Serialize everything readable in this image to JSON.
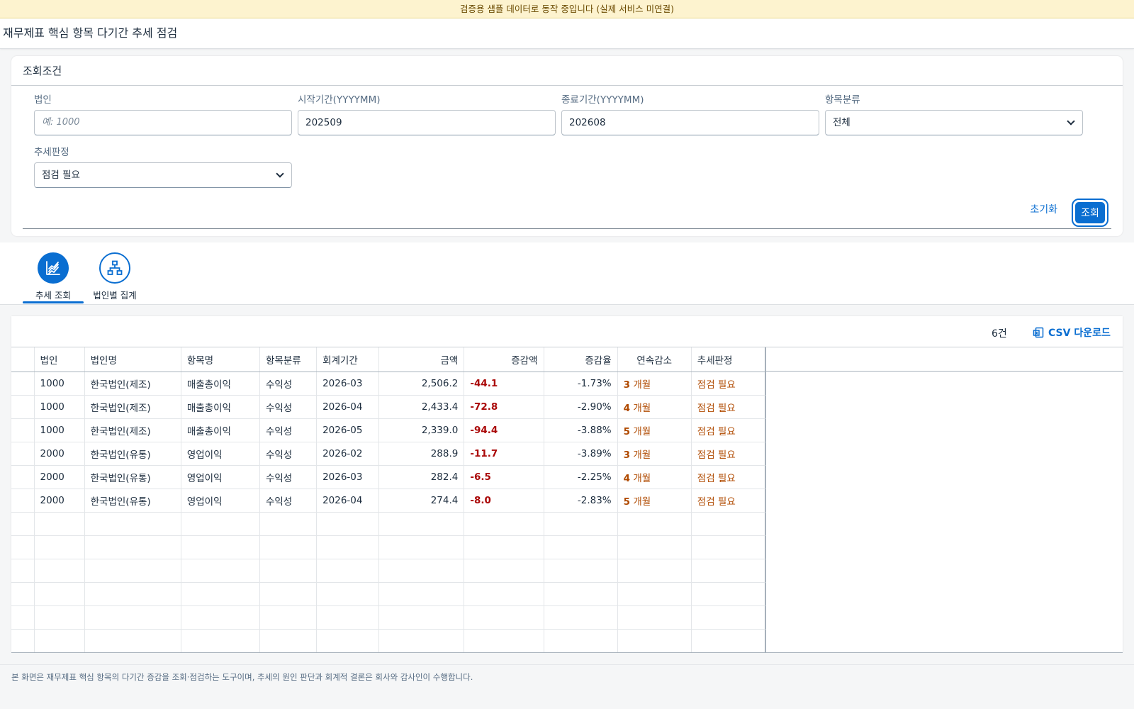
{
  "banner": {
    "text": "검증용 샘플 데이터로 동작 중입니다 (실제 서비스 미연결)"
  },
  "shell": {
    "title": "재무제표 핵심 항목 다기간 추세 점검"
  },
  "filter": {
    "title": "조회조건",
    "fields": {
      "corp": {
        "label": "법인",
        "placeholder": "예: 1000",
        "value": ""
      },
      "start": {
        "label": "시작기간(YYYYMM)",
        "value": "202509"
      },
      "end": {
        "label": "종료기간(YYYYMM)",
        "value": "202608"
      },
      "category": {
        "label": "항목분류",
        "value": "전체"
      },
      "trend": {
        "label": "추세판정",
        "value": "점검 필요"
      }
    },
    "reset_label": "초기화",
    "search_label": "조회"
  },
  "tabs": [
    {
      "label": "추세 조회",
      "icon": "line-chart-icon",
      "active": true
    },
    {
      "label": "법인별 집계",
      "icon": "org-hierarchy-icon",
      "active": false
    }
  ],
  "table": {
    "count": "6건",
    "csv_label": "CSV 다운로드",
    "columns": [
      "법인",
      "법인명",
      "항목명",
      "항목분류",
      "회계기간",
      "금액",
      "증감액",
      "증감율",
      "연속감소",
      "추세판정"
    ],
    "rows": [
      {
        "corp": "1000",
        "corp_name": "한국법인(제조)",
        "item": "매출총이익",
        "category": "수익성",
        "period": "2026-03",
        "amount": "2,506.2",
        "change": "-44.1",
        "rate": "-1.73%",
        "streak_num": "3",
        "streak_unit": "개월",
        "judgement": "점검 필요"
      },
      {
        "corp": "1000",
        "corp_name": "한국법인(제조)",
        "item": "매출총이익",
        "category": "수익성",
        "period": "2026-04",
        "amount": "2,433.4",
        "change": "-72.8",
        "rate": "-2.90%",
        "streak_num": "4",
        "streak_unit": "개월",
        "judgement": "점검 필요"
      },
      {
        "corp": "1000",
        "corp_name": "한국법인(제조)",
        "item": "매출총이익",
        "category": "수익성",
        "period": "2026-05",
        "amount": "2,339.0",
        "change": "-94.4",
        "rate": "-3.88%",
        "streak_num": "5",
        "streak_unit": "개월",
        "judgement": "점검 필요"
      },
      {
        "corp": "2000",
        "corp_name": "한국법인(유통)",
        "item": "영업이익",
        "category": "수익성",
        "period": "2026-02",
        "amount": "288.9",
        "change": "-11.7",
        "rate": "-3.89%",
        "streak_num": "3",
        "streak_unit": "개월",
        "judgement": "점검 필요"
      },
      {
        "corp": "2000",
        "corp_name": "한국법인(유통)",
        "item": "영업이익",
        "category": "수익성",
        "period": "2026-03",
        "amount": "282.4",
        "change": "-6.5",
        "rate": "-2.25%",
        "streak_num": "4",
        "streak_unit": "개월",
        "judgement": "점검 필요"
      },
      {
        "corp": "2000",
        "corp_name": "한국법인(유통)",
        "item": "영업이익",
        "category": "수익성",
        "period": "2026-04",
        "amount": "274.4",
        "change": "-8.0",
        "rate": "-2.83%",
        "streak_num": "5",
        "streak_unit": "개월",
        "judgement": "점검 필요"
      }
    ]
  },
  "footer": {
    "note": "본 화면은 재무제표 핵심 항목의 다기간 증감을 조회·점검하는 도구이며, 추세의 원인 판단과 회계적 결론은 회사와 감사인이 수행합니다."
  },
  "colors": {
    "accent": "#0a6ed1",
    "negative": "#aa0808",
    "warning": "#b04a00",
    "banner_bg": "#fdf3cf"
  }
}
